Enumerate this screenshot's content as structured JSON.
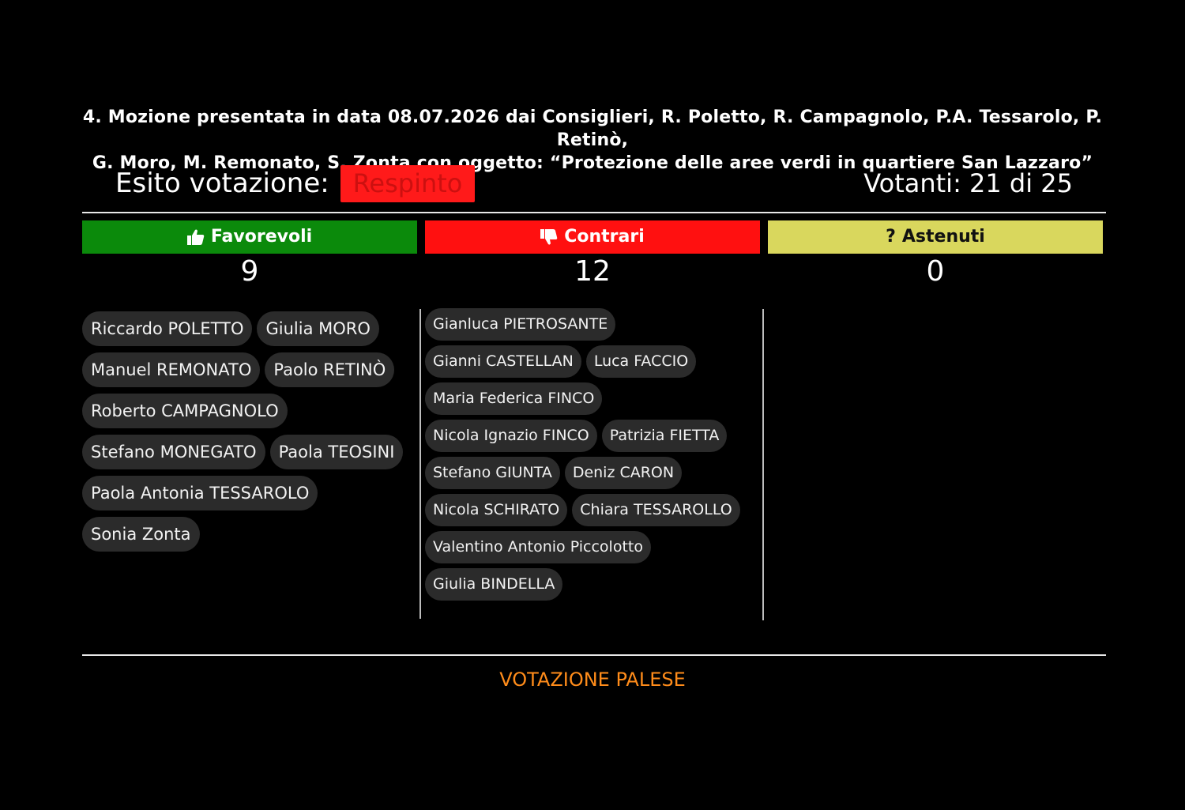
{
  "title": {
    "line1": "4. Mozione presentata in data 08.07.2026 dai Consiglieri, R. Poletto, R. Campagnolo, P.A. Tessarolo, P. Retinò,",
    "line2": "G. Moro, M. Remonato, S. Zonta con oggetto: “Protezione delle aree verdi in quartiere San Lazzaro”"
  },
  "esito": {
    "label": "Esito votazione:",
    "value": "Respinto"
  },
  "votanti": "Votanti: 21 di 25",
  "columns": {
    "favorevoli": {
      "label": "Favorevoli",
      "count": "9",
      "icon": "thumbs-up-icon",
      "color": "#0b8a0b"
    },
    "contrari": {
      "label": "Contrari",
      "count": "12",
      "icon": "thumbs-down-icon",
      "color": "#ff1010"
    },
    "astenuti": {
      "label": "Astenuti",
      "count": "0",
      "icon": "question-mark",
      "symbol": "?",
      "color": "#d9d75d"
    }
  },
  "favorevoli_names": [
    "Riccardo POLETTO",
    "Giulia MORO",
    "Manuel REMONATO",
    "Paolo RETINÒ",
    "Roberto CAMPAGNOLO",
    "Stefano MONEGATO",
    "Paola TEOSINI",
    "Paola Antonia TESSAROLO",
    "Sonia Zonta"
  ],
  "contrari_names": [
    "Gianluca PIETROSANTE",
    "Gianni CASTELLAN",
    "Luca FACCIO",
    "Maria Federica FINCO",
    "Nicola Ignazio FINCO",
    "Patrizia FIETTA",
    "Stefano GIUNTA",
    "Deniz CARON",
    "Nicola SCHIRATO",
    "Chiara TESSAROLLO",
    "Valentino Antonio Piccolotto",
    "Giulia BINDELLA"
  ],
  "footer": "VOTAZIONE PALESE"
}
